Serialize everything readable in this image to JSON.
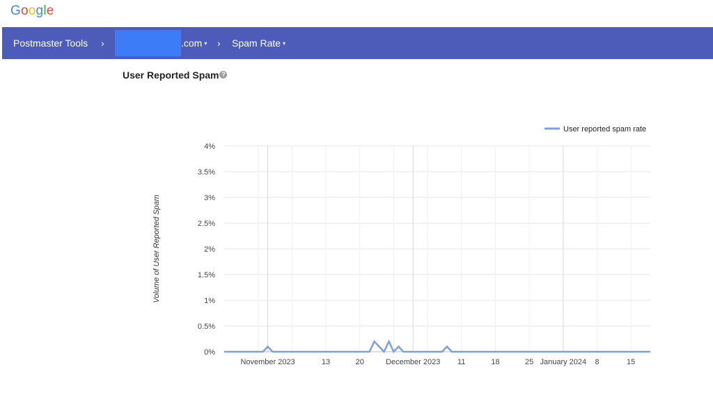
{
  "logo": {
    "letters": [
      "G",
      "o",
      "o",
      "g",
      "l",
      "e"
    ],
    "colors": [
      "#4285f4",
      "#ea4335",
      "#fbbc05",
      "#4285f4",
      "#34a853",
      "#ea4335"
    ]
  },
  "topbar": {
    "color": "#4c5cb8",
    "app_title": "Postmaster Tools",
    "separator": "›",
    "domain_suffix": ".com",
    "section": "Spam Rate",
    "caret": "▾"
  },
  "page": {
    "title": "User Reported Spam"
  },
  "chart_data": {
    "type": "line",
    "ylabel": "Volume of User Reported Spam",
    "yticks": [
      "0%",
      "0.5%",
      "1%",
      "1.5%",
      "2%",
      "2.5%",
      "3%",
      "3.5%",
      "4%"
    ],
    "ylim": [
      0,
      4
    ],
    "grid": true,
    "legend_position": "top-right",
    "x_range": [
      "2023-10-23",
      "2024-01-19"
    ],
    "xticks": [
      {
        "date": "2023-11-01",
        "label": "November 2023",
        "major": true
      },
      {
        "date": "2023-11-13",
        "label": "13",
        "major": false
      },
      {
        "date": "2023-11-20",
        "label": "20",
        "major": false
      },
      {
        "date": "2023-12-01",
        "label": "December 2023",
        "major": true
      },
      {
        "date": "2023-12-11",
        "label": "11",
        "major": false
      },
      {
        "date": "2023-12-18",
        "label": "18",
        "major": false
      },
      {
        "date": "2023-12-25",
        "label": "25",
        "major": false
      },
      {
        "date": "2024-01-01",
        "label": "January 2024",
        "major": true
      },
      {
        "date": "2024-01-08",
        "label": "8",
        "major": false
      },
      {
        "date": "2024-01-15",
        "label": "15",
        "major": false
      }
    ],
    "series": [
      {
        "name": "User reported spam rate",
        "color": "#7b9ee6",
        "points": [
          {
            "x": "2023-10-23",
            "y": 0
          },
          {
            "x": "2023-10-31",
            "y": 0
          },
          {
            "x": "2023-11-01",
            "y": 0.1
          },
          {
            "x": "2023-11-02",
            "y": 0
          },
          {
            "x": "2023-11-22",
            "y": 0
          },
          {
            "x": "2023-11-23",
            "y": 0.2
          },
          {
            "x": "2023-11-25",
            "y": 0
          },
          {
            "x": "2023-11-26",
            "y": 0.2
          },
          {
            "x": "2023-11-27",
            "y": 0
          },
          {
            "x": "2023-11-28",
            "y": 0.1
          },
          {
            "x": "2023-11-29",
            "y": 0
          },
          {
            "x": "2023-12-07",
            "y": 0
          },
          {
            "x": "2023-12-08",
            "y": 0.1
          },
          {
            "x": "2023-12-09",
            "y": 0
          },
          {
            "x": "2024-01-19",
            "y": 0
          }
        ]
      }
    ]
  }
}
